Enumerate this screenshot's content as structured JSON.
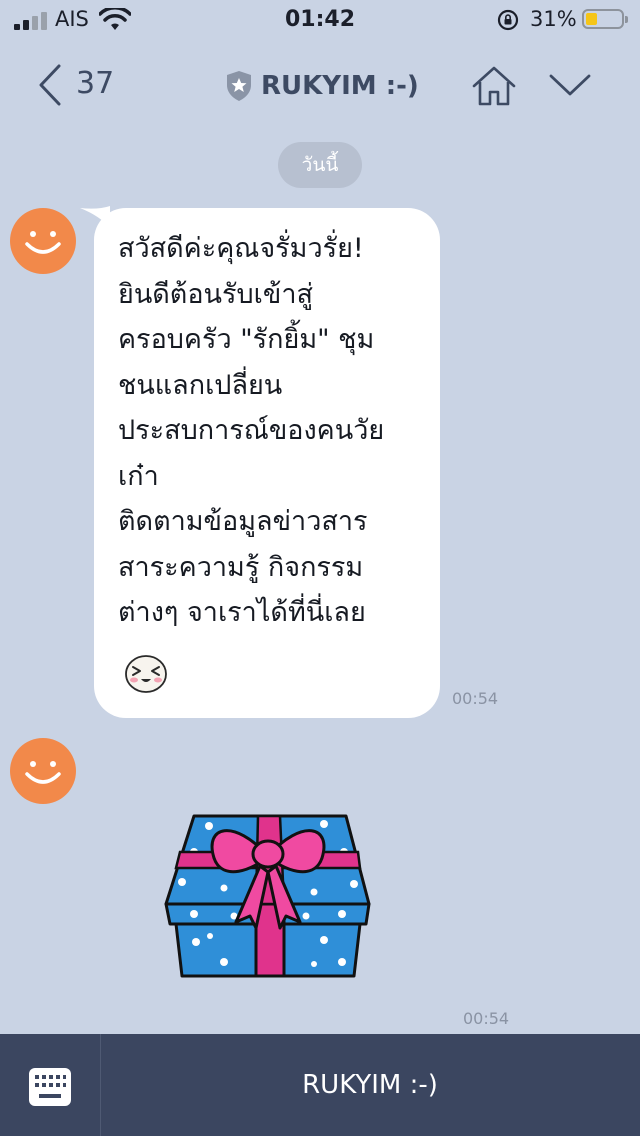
{
  "status_bar": {
    "carrier": "AIS",
    "time": "01:42",
    "battery_percent": "31%",
    "battery_level": 0.31
  },
  "header": {
    "back_count": "37",
    "title": "RUKYIM :-)"
  },
  "chat": {
    "date_label": "วันนี้",
    "messages": [
      {
        "lines": [
          "สวัสดีค่ะคุณจรั่มวรั่ย!",
          "ยินดีต้อนรับเข้าสู่",
          "ครอบครัว \"รักยิ้ม\" ชุม",
          "ชนแลกเปลี่ยน",
          "ประสบการณ์ของคนวัย",
          "เก๋า",
          "ติดตามข้อมูลข่าวสาร",
          "สาระความรู้ กิจกรรม",
          "ต่างๆ จาเราได้ที่นี่เลย"
        ],
        "time": "00:54"
      },
      {
        "sticker": "gift-box",
        "time": "00:54"
      }
    ]
  },
  "bottom_bar": {
    "label": "RUKYIM :-)"
  },
  "icons": [
    "signal-icon",
    "wifi-icon",
    "rotation-lock-icon",
    "battery-icon",
    "back-chevron-icon",
    "shield-star-icon",
    "home-icon",
    "chevron-down-icon",
    "smile-avatar-icon",
    "laughing-emoji-sticker",
    "gift-box-sticker",
    "keyboard-icon"
  ],
  "colors": {
    "background": "#c9d3e4",
    "avatar": "#f2894a",
    "bottom_bar": "#3b4660",
    "header_text": "#3d4a63",
    "battery": "#f5c518"
  }
}
